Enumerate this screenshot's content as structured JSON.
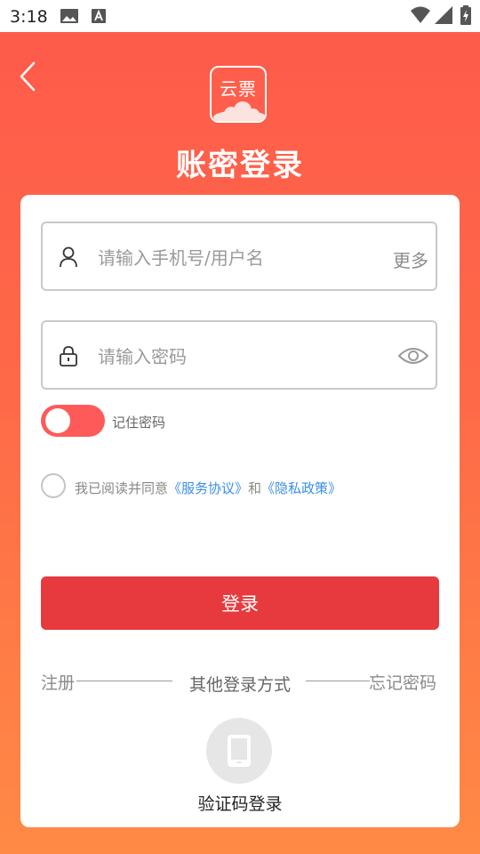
{
  "status_bar": {
    "time": "3:18",
    "icons": [
      "image-icon",
      "font-icon",
      "wifi-icon",
      "signal-icon",
      "battery-charging-icon"
    ]
  },
  "header": {
    "back_icon": "chevron-left-icon",
    "logo_text": "云票",
    "title": "账密登录"
  },
  "form": {
    "username": {
      "placeholder": "请输入手机号/用户名",
      "value": "",
      "more_label": "更多",
      "icon": "user-icon"
    },
    "password": {
      "placeholder": "请输入密码",
      "value": "",
      "icon": "lock-icon",
      "toggle_icon": "eye-icon"
    },
    "remember": {
      "label": "记住密码",
      "on": true
    },
    "agreement": {
      "prefix": "我已阅读并同意",
      "service_link": "《服务协议》",
      "and": "和",
      "privacy_link": "《隐私政策》",
      "checked": false
    },
    "login_label": "登录"
  },
  "footer": {
    "register_label": "注册",
    "other_methods_label": "其他登录方式",
    "forgot_label": "忘记密码",
    "sms_login_label": "验证码登录",
    "sms_icon": "phone-icon"
  },
  "colors": {
    "header_gradient_top": "#fe5b4a",
    "header_gradient_bottom": "#ff8a45",
    "login_button": "#e63a3e",
    "toggle_on": "#ff5a5a",
    "link": "#3a8ee6"
  }
}
